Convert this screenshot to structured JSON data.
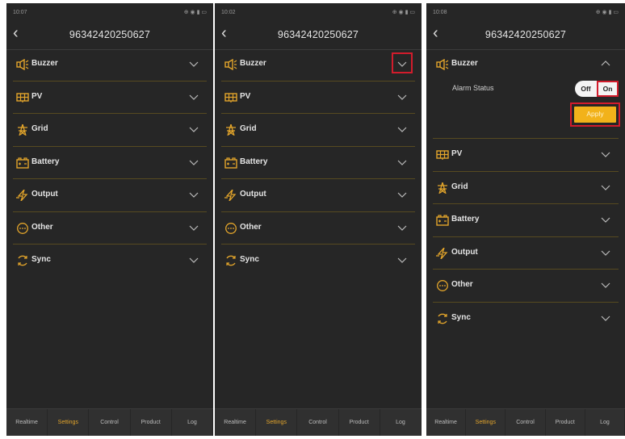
{
  "screens": [
    {
      "status_time": "10:07",
      "status_right": "⊕ ◉ ▮ ▭",
      "device_id": "96342420250627",
      "sections": [
        {
          "label": "Buzzer",
          "icon": "buzzer-icon"
        },
        {
          "label": "PV",
          "icon": "pv-panel-icon"
        },
        {
          "label": "Grid",
          "icon": "grid-tower-icon"
        },
        {
          "label": "Battery",
          "icon": "battery-icon"
        },
        {
          "label": "Output",
          "icon": "output-bolt-icon"
        },
        {
          "label": "Other",
          "icon": "other-dots-icon"
        },
        {
          "label": "Sync",
          "icon": "sync-icon"
        }
      ],
      "tabs": [
        "Realtime",
        "Settings",
        "Control",
        "Product",
        "Log"
      ],
      "active_tab": "Settings"
    },
    {
      "status_time": "10:02",
      "status_right": "⊕ ◉ ▮ ▭",
      "device_id": "96342420250627",
      "sections": [
        {
          "label": "Buzzer",
          "icon": "buzzer-icon"
        },
        {
          "label": "PV",
          "icon": "pv-panel-icon"
        },
        {
          "label": "Grid",
          "icon": "grid-tower-icon"
        },
        {
          "label": "Battery",
          "icon": "battery-icon"
        },
        {
          "label": "Output",
          "icon": "output-bolt-icon"
        },
        {
          "label": "Other",
          "icon": "other-dots-icon"
        },
        {
          "label": "Sync",
          "icon": "sync-icon"
        }
      ],
      "tabs": [
        "Realtime",
        "Settings",
        "Control",
        "Product",
        "Log"
      ],
      "active_tab": "Settings"
    },
    {
      "status_time": "10:08",
      "status_right": "⊕ ◉ ▮ ▭",
      "device_id": "96342420250627",
      "sections": [
        {
          "label": "Buzzer",
          "icon": "buzzer-icon"
        },
        {
          "label": "PV",
          "icon": "pv-panel-icon"
        },
        {
          "label": "Grid",
          "icon": "grid-tower-icon"
        },
        {
          "label": "Battery",
          "icon": "battery-icon"
        },
        {
          "label": "Output",
          "icon": "output-bolt-icon"
        },
        {
          "label": "Other",
          "icon": "other-dots-icon"
        },
        {
          "label": "Sync",
          "icon": "sync-icon"
        }
      ],
      "buzzer_panel": {
        "alarm_label": "Alarm Status",
        "off_label": "Off",
        "on_label": "On",
        "apply_label": "Apply"
      },
      "tabs": [
        "Realtime",
        "Settings",
        "Control",
        "Product",
        "Log"
      ],
      "active_tab": "Settings"
    }
  ],
  "colors": {
    "background": "#262626",
    "accent": "#e3a52b",
    "divider": "#574a20",
    "highlight": "#d21c2c",
    "apply": "#f2b21a"
  }
}
